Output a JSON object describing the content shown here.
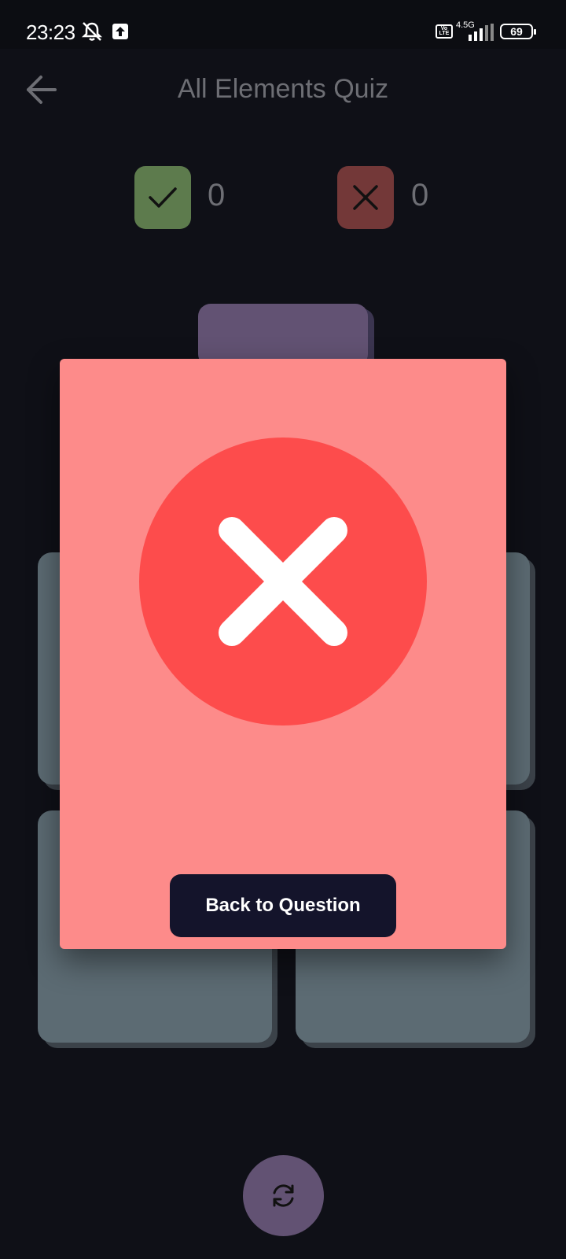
{
  "status_bar": {
    "time": "23:23",
    "network_type": "4.5G",
    "volte_label": "Vo LTE",
    "battery_level": "69",
    "icons": [
      "mute-icon",
      "upload-icon",
      "volte-icon",
      "signal-icon",
      "battery-icon"
    ]
  },
  "header": {
    "title": "All Elements Quiz",
    "back_icon": "arrow-left-icon"
  },
  "score": {
    "correct_count": "0",
    "wrong_count": "0",
    "correct_icon": "check-icon",
    "wrong_icon": "close-icon",
    "correct_color": "#5d7b4d",
    "wrong_color": "#733838"
  },
  "dialog": {
    "result_icon": "close-circle-icon",
    "button_label": "Back to Question",
    "background_color": "#fd8b8a",
    "circle_color": "#fd4c4c"
  },
  "footer": {
    "refresh_icon": "refresh-icon"
  },
  "colors": {
    "background": "#0f1017",
    "question_card": "#625273",
    "answer_card": "#5c6b73"
  }
}
